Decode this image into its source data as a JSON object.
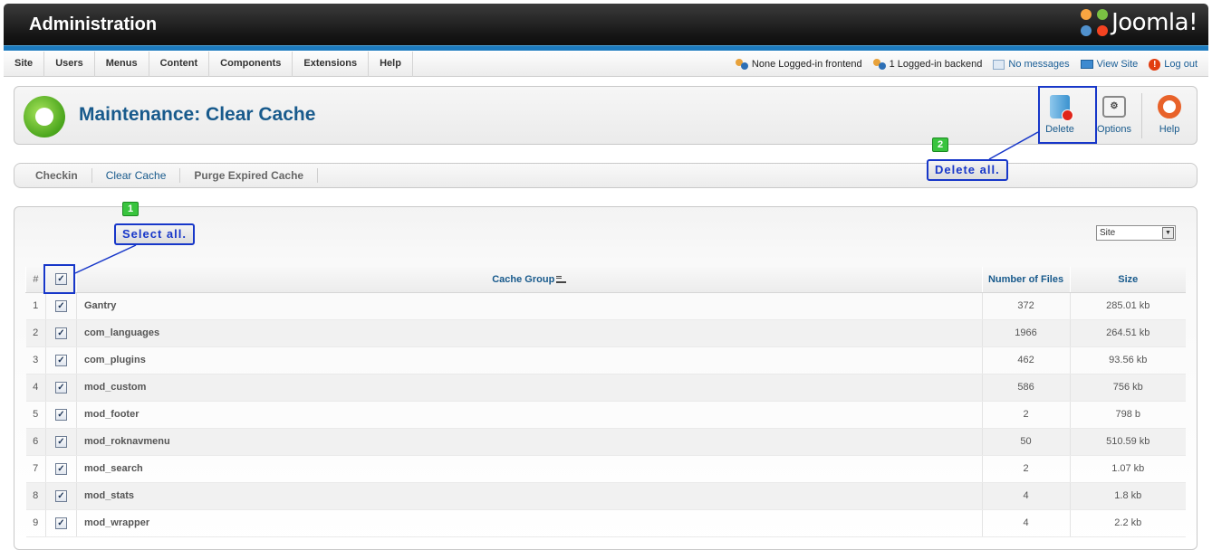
{
  "header": {
    "title": "Administration",
    "logo_text": "Joomla!"
  },
  "menu": [
    "Site",
    "Users",
    "Menus",
    "Content",
    "Components",
    "Extensions",
    "Help"
  ],
  "status": {
    "frontend": "None Logged-in frontend",
    "backend": "1 Logged-in backend",
    "messages": "No messages",
    "view_site": "View Site",
    "logout": "Log out"
  },
  "page": {
    "title": "Maintenance: Clear Cache"
  },
  "toolbar": {
    "delete": "Delete",
    "options": "Options",
    "help": "Help"
  },
  "subtabs": [
    "Checkin",
    "Clear Cache",
    "Purge Expired Cache"
  ],
  "filter": {
    "selected": "Site"
  },
  "table": {
    "headers": {
      "num": "#",
      "group": "Cache Group",
      "files": "Number of Files",
      "size": "Size"
    },
    "rows": [
      {
        "n": "1",
        "group": "Gantry",
        "files": "372",
        "size": "285.01 kb"
      },
      {
        "n": "2",
        "group": "com_languages",
        "files": "1966",
        "size": "264.51 kb"
      },
      {
        "n": "3",
        "group": "com_plugins",
        "files": "462",
        "size": "93.56 kb"
      },
      {
        "n": "4",
        "group": "mod_custom",
        "files": "586",
        "size": "756 kb"
      },
      {
        "n": "5",
        "group": "mod_footer",
        "files": "2",
        "size": "798 b"
      },
      {
        "n": "6",
        "group": "mod_roknavmenu",
        "files": "50",
        "size": "510.59 kb"
      },
      {
        "n": "7",
        "group": "mod_search",
        "files": "2",
        "size": "1.07 kb"
      },
      {
        "n": "8",
        "group": "mod_stats",
        "files": "4",
        "size": "1.8 kb"
      },
      {
        "n": "9",
        "group": "mod_wrapper",
        "files": "4",
        "size": "2.2 kb"
      }
    ]
  },
  "annotations": {
    "step1": {
      "num": "1",
      "text": "Select all."
    },
    "step2": {
      "num": "2",
      "text": "Delete all."
    }
  },
  "colors": {
    "accent": "#185a8c",
    "annotation": "#1737c9",
    "header_stripe": "#1d7bbf"
  }
}
